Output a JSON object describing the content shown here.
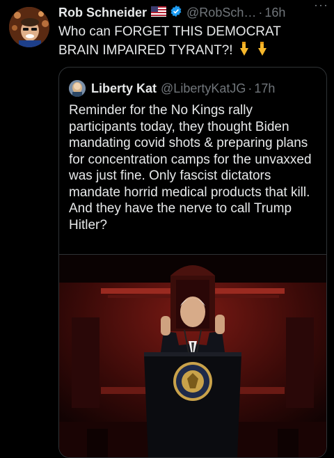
{
  "tweet": {
    "author_name": "Rob Schneider",
    "author_handle": "@RobSch…",
    "time": "16h",
    "text": "Who can FORGET THIS DEMOCRAT BRAIN IMPAIRED TYRANT?!",
    "flag_icon": "us-flag-icon",
    "pointer_icons": [
      "pointing-down-emoji",
      "pointing-down-emoji"
    ]
  },
  "quote": {
    "author_name": "Liberty Kat",
    "author_handle": "@LibertyKatJG",
    "time": "17h",
    "text": "Reminder for the No Kings rally participants today, they thought Biden mandating covid shots & preparing plans for concentration camps for the unvaxxed was just fine. Only fascist dictators mandate horrid medical products that kill. And they have the nerve to call Trump Hitler?",
    "media_description_icon": "photo"
  },
  "colors": {
    "background": "#000000",
    "text": "#e7e9ea",
    "muted": "#71767b",
    "verified": "#1d9bf0",
    "border": "#2f3336"
  }
}
